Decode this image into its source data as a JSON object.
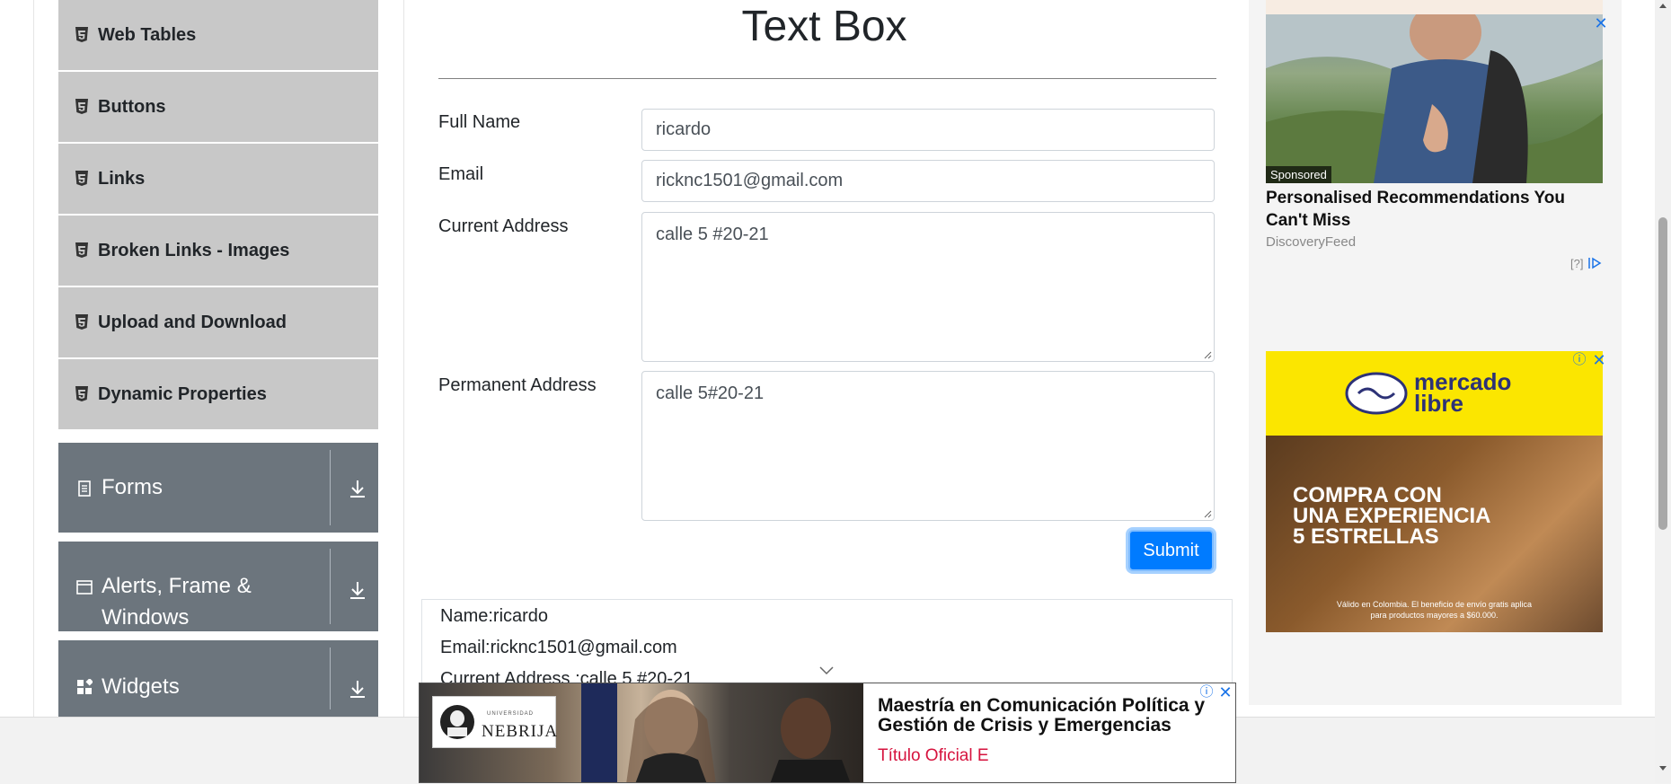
{
  "sidebar": {
    "element_items": [
      {
        "label": "Web Tables"
      },
      {
        "label": "Buttons"
      },
      {
        "label": "Links"
      },
      {
        "label": "Broken Links - Images"
      },
      {
        "label": "Upload and Download"
      },
      {
        "label": "Dynamic Properties"
      }
    ],
    "groups": [
      {
        "label": "Forms"
      },
      {
        "label_line1": "Alerts, Frame &",
        "label_line2": "Windows"
      },
      {
        "label": "Widgets"
      }
    ]
  },
  "main": {
    "title": "Text Box",
    "form": {
      "full_name": {
        "label": "Full Name",
        "value": "ricardo"
      },
      "email": {
        "label": "Email",
        "value": "ricknc1501@gmail.com"
      },
      "current_address": {
        "label": "Current Address",
        "value": "calle 5 #20-21"
      },
      "permanent_address": {
        "label": "Permanent Address",
        "value": "calle 5#20-21"
      },
      "submit_label": "Submit"
    },
    "output": {
      "name_line": "Name:ricardo",
      "email_line": "Email:ricknc1501@gmail.com",
      "current_line": "Current Address :calle 5 #20-21"
    }
  },
  "ads": {
    "ad1": {
      "sponsored": "Sponsored",
      "title": "Personalised Recommendations You Can't Miss",
      "source": "DiscoveryFeed",
      "choice": "[?]"
    },
    "ad2": {
      "brand_line1": "mercado",
      "brand_line2": "libre",
      "headline_line1": "COMPRA CON",
      "headline_line2": "UNA EXPERIENCIA",
      "headline_line3": "5 ESTRELLAS",
      "fineprint_line1": "Válido en Colombia. El beneficio de envío gratis aplica",
      "fineprint_line2": "para productos mayores a $60.000."
    },
    "bottom": {
      "logo_small": "UNIVERSIDAD",
      "logo_name": "NEBRIJA",
      "title": "Maestría en Comunicación Política y Gestión de Crisis y Emergencias",
      "subtitle": "Título Oficial E"
    }
  },
  "colors": {
    "sidebar_item_bg": "#c8c8c8",
    "group_bg": "#6c757d",
    "submit_bg": "#007bff",
    "ad_yellow": "#fbe600",
    "bottom_ad_red": "#d6133e"
  }
}
